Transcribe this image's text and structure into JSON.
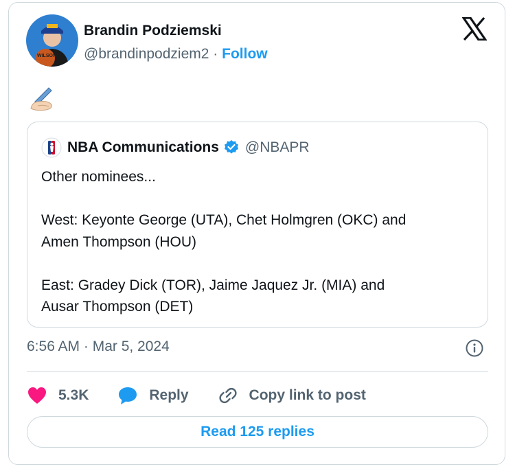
{
  "author": {
    "name": "Brandin Podziemski",
    "handle": "@brandinpodziem2",
    "separator": "·",
    "follow_label": "Follow"
  },
  "tweet": {
    "emoji": "✍🏻"
  },
  "quoted_tweet": {
    "name": "NBA Communications",
    "handle": "@NBAPR",
    "lines": [
      "Other nominees...",
      "",
      "West: Keyonte George (UTA), Chet Holmgren (OKC) and",
      "Amen Thompson (HOU)",
      "",
      "East: Gradey Dick (TOR), Jaime Jaquez Jr. (MIA) and",
      "Ausar Thompson (DET)"
    ]
  },
  "timestamp": "6:56 AM · Mar 5, 2024",
  "actions": {
    "like_count": "5.3K",
    "reply_label": "Reply",
    "copy_link_label": "Copy link to post"
  },
  "read_replies_label": "Read 125 replies",
  "colors": {
    "accent": "#1d9bf0",
    "like": "#f91880",
    "muted": "#536471",
    "border": "#cfd9de"
  },
  "icons": [
    "x-logo-icon",
    "writing-hand-icon",
    "nba-logo-icon",
    "verified-badge-icon",
    "info-icon",
    "heart-icon",
    "reply-bubble-icon",
    "link-icon"
  ]
}
